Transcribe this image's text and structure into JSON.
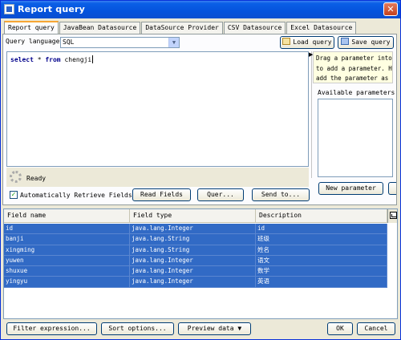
{
  "window": {
    "title": "Report query",
    "close_glyph": "✕"
  },
  "tabs": [
    {
      "label": "Report query",
      "active": true
    },
    {
      "label": "JavaBean Datasource",
      "active": false
    },
    {
      "label": "DataSource Provider",
      "active": false
    },
    {
      "label": "CSV Datasource",
      "active": false
    },
    {
      "label": "Excel Datasource",
      "active": false
    }
  ],
  "query": {
    "language_label": "Query language",
    "language_value": "SQL",
    "load_label": "Load query",
    "save_label": "Save query",
    "text_keyword1": "select",
    "text_mid": " * ",
    "text_keyword2": "from",
    "text_rest": " chengji"
  },
  "status": {
    "ready": "Ready"
  },
  "options": {
    "auto_retrieve_label": "Automatically Retrieve Fields",
    "read_fields_label": "Read Fields",
    "query_designer_label": "Quer...",
    "send_to_label": "Send to..."
  },
  "parameters": {
    "hint_line1": "Drag a parameter into",
    "hint_line2": "to add a parameter. Ho",
    "hint_line3": "add the parameter as c",
    "available_label": "Available parameters",
    "new_parameter_label": "New parameter"
  },
  "table": {
    "headers": [
      "Field name",
      "Field type",
      "Description"
    ],
    "rows": [
      [
        "id",
        "java.lang.Integer",
        "id"
      ],
      [
        "banji",
        "java.lang.String",
        "班级"
      ],
      [
        "xingming",
        "java.lang.String",
        "姓名"
      ],
      [
        "yuwen",
        "java.lang.Integer",
        "语文"
      ],
      [
        "shuxue",
        "java.lang.Integer",
        "数学"
      ],
      [
        "yingyu",
        "java.lang.Integer",
        "英语"
      ]
    ]
  },
  "footer": {
    "filter_label": "Filter expression...",
    "sort_label": "Sort options...",
    "preview_label": "Preview data",
    "ok_label": "OK",
    "cancel_label": "Cancel"
  },
  "colors": {
    "selection": "#316ac5",
    "title_bar": "#0553dd",
    "tab_highlight": "#f7a635"
  }
}
